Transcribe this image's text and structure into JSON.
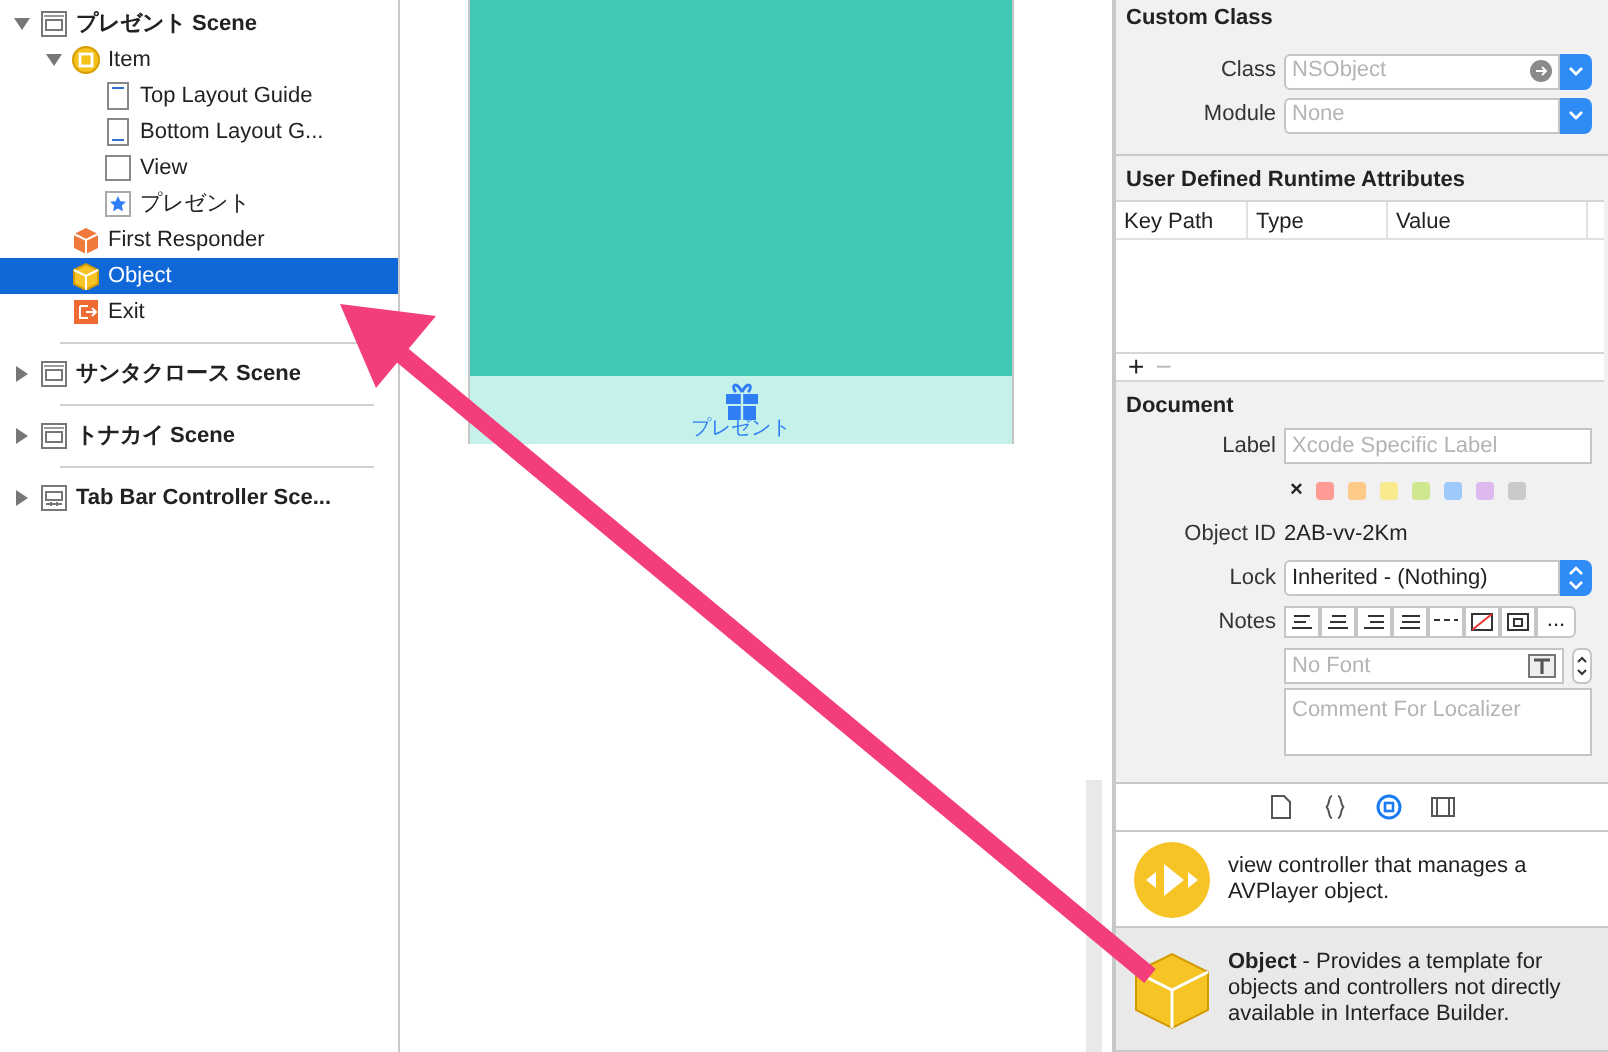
{
  "outline": {
    "items": [
      {
        "label": "プレゼント Scene",
        "kind": "scene",
        "expanded": true,
        "selected": false,
        "children": [
          {
            "label": "Item",
            "kind": "item",
            "expanded": true,
            "selected": false,
            "children": [
              {
                "label": "Top Layout Guide",
                "kind": "top-guide",
                "selected": false
              },
              {
                "label": "Bottom Layout G...",
                "kind": "bottom-guide",
                "selected": false
              },
              {
                "label": "View",
                "kind": "view",
                "selected": false
              },
              {
                "label": "プレゼント",
                "kind": "tab-item",
                "selected": false
              }
            ]
          },
          {
            "label": "First Responder",
            "kind": "responder",
            "selected": false
          },
          {
            "label": "Object",
            "kind": "object",
            "selected": true
          },
          {
            "label": "Exit",
            "kind": "exit",
            "selected": false
          }
        ]
      },
      {
        "label": "サンタクロース Scene",
        "kind": "scene",
        "expanded": false,
        "selected": false
      },
      {
        "label": "トナカイ Scene",
        "kind": "scene",
        "expanded": false,
        "selected": false
      },
      {
        "label": "Tab Bar Controller Sce...",
        "kind": "tab-scene",
        "expanded": false,
        "selected": false
      }
    ]
  },
  "canvas": {
    "tab_label": "プレゼント"
  },
  "inspector": {
    "custom_class": {
      "title": "Custom Class",
      "fields": [
        {
          "label": "Class",
          "placeholder": "NSObject",
          "kind": "class"
        },
        {
          "label": "Module",
          "placeholder": "None",
          "kind": "module"
        }
      ]
    },
    "runtime_attributes": {
      "title": "User Defined Runtime Attributes",
      "columns": [
        "Key Path",
        "Type",
        "Value"
      ],
      "add": "+",
      "remove": "−"
    },
    "document": {
      "title": "Document",
      "label": {
        "label": "Label",
        "placeholder": "Xcode Specific Label"
      },
      "clear": "×",
      "colors": [
        {
          "color": "#ff9b95"
        },
        {
          "color": "#fdca88"
        },
        {
          "color": "#f9ea8f"
        },
        {
          "color": "#cfe78f"
        },
        {
          "color": "#9dc9fb"
        },
        {
          "color": "#ddb9ef"
        },
        {
          "color": "#c9c9c9"
        }
      ],
      "object_id": {
        "label": "Object ID",
        "value": "2AB-vv-2Km"
      },
      "lock": {
        "label": "Lock",
        "value": "Inherited - (Nothing)"
      },
      "notes": {
        "label": "Notes",
        "more": "..."
      },
      "font": {
        "placeholder": "No Font"
      },
      "comment": {
        "placeholder": "Comment For Localizer"
      }
    }
  },
  "library": {
    "tabs": [
      {
        "kind": "file",
        "selected": false
      },
      {
        "kind": "code",
        "selected": false
      },
      {
        "kind": "object",
        "selected": true
      },
      {
        "kind": "media",
        "selected": false
      }
    ],
    "items": [
      {
        "kind": "player",
        "text": "view controller that manages a AVPlayer object.",
        "selected": false
      },
      {
        "kind": "object",
        "text": "**Object** - Provides a template for objects and controllers not directly available in Interface Builder.",
        "selected": true
      }
    ]
  }
}
